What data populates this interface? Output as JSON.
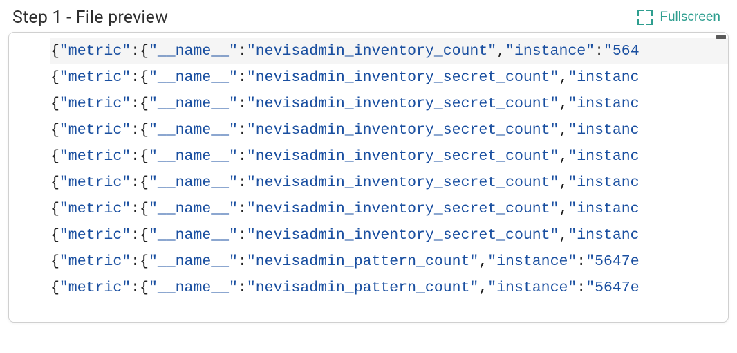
{
  "header": {
    "title": "Step 1 - File preview",
    "fullscreen_label": "Fullscreen"
  },
  "preview": {
    "lines": [
      {
        "tokens": [
          {
            "t": "punct",
            "v": "{"
          },
          {
            "t": "key",
            "v": "\"metric\""
          },
          {
            "t": "punct",
            "v": ":{"
          },
          {
            "t": "key",
            "v": "\"__name__\""
          },
          {
            "t": "punct",
            "v": ":"
          },
          {
            "t": "str",
            "v": "\"nevisadmin_inventory_count\""
          },
          {
            "t": "punct",
            "v": ","
          },
          {
            "t": "key",
            "v": "\"instance\""
          },
          {
            "t": "punct",
            "v": ":"
          },
          {
            "t": "str",
            "v": "\"564"
          }
        ],
        "first": true
      },
      {
        "tokens": [
          {
            "t": "punct",
            "v": "{"
          },
          {
            "t": "key",
            "v": "\"metric\""
          },
          {
            "t": "punct",
            "v": ":{"
          },
          {
            "t": "key",
            "v": "\"__name__\""
          },
          {
            "t": "punct",
            "v": ":"
          },
          {
            "t": "str",
            "v": "\"nevisadmin_inventory_secret_count\""
          },
          {
            "t": "punct",
            "v": ","
          },
          {
            "t": "key",
            "v": "\"instanc"
          }
        ]
      },
      {
        "tokens": [
          {
            "t": "punct",
            "v": "{"
          },
          {
            "t": "key",
            "v": "\"metric\""
          },
          {
            "t": "punct",
            "v": ":{"
          },
          {
            "t": "key",
            "v": "\"__name__\""
          },
          {
            "t": "punct",
            "v": ":"
          },
          {
            "t": "str",
            "v": "\"nevisadmin_inventory_secret_count\""
          },
          {
            "t": "punct",
            "v": ","
          },
          {
            "t": "key",
            "v": "\"instanc"
          }
        ]
      },
      {
        "tokens": [
          {
            "t": "punct",
            "v": "{"
          },
          {
            "t": "key",
            "v": "\"metric\""
          },
          {
            "t": "punct",
            "v": ":{"
          },
          {
            "t": "key",
            "v": "\"__name__\""
          },
          {
            "t": "punct",
            "v": ":"
          },
          {
            "t": "str",
            "v": "\"nevisadmin_inventory_secret_count\""
          },
          {
            "t": "punct",
            "v": ","
          },
          {
            "t": "key",
            "v": "\"instanc"
          }
        ]
      },
      {
        "tokens": [
          {
            "t": "punct",
            "v": "{"
          },
          {
            "t": "key",
            "v": "\"metric\""
          },
          {
            "t": "punct",
            "v": ":{"
          },
          {
            "t": "key",
            "v": "\"__name__\""
          },
          {
            "t": "punct",
            "v": ":"
          },
          {
            "t": "str",
            "v": "\"nevisadmin_inventory_secret_count\""
          },
          {
            "t": "punct",
            "v": ","
          },
          {
            "t": "key",
            "v": "\"instanc"
          }
        ]
      },
      {
        "tokens": [
          {
            "t": "punct",
            "v": "{"
          },
          {
            "t": "key",
            "v": "\"metric\""
          },
          {
            "t": "punct",
            "v": ":{"
          },
          {
            "t": "key",
            "v": "\"__name__\""
          },
          {
            "t": "punct",
            "v": ":"
          },
          {
            "t": "str",
            "v": "\"nevisadmin_inventory_secret_count\""
          },
          {
            "t": "punct",
            "v": ","
          },
          {
            "t": "key",
            "v": "\"instanc"
          }
        ]
      },
      {
        "tokens": [
          {
            "t": "punct",
            "v": "{"
          },
          {
            "t": "key",
            "v": "\"metric\""
          },
          {
            "t": "punct",
            "v": ":{"
          },
          {
            "t": "key",
            "v": "\"__name__\""
          },
          {
            "t": "punct",
            "v": ":"
          },
          {
            "t": "str",
            "v": "\"nevisadmin_inventory_secret_count\""
          },
          {
            "t": "punct",
            "v": ","
          },
          {
            "t": "key",
            "v": "\"instanc"
          }
        ]
      },
      {
        "tokens": [
          {
            "t": "punct",
            "v": "{"
          },
          {
            "t": "key",
            "v": "\"metric\""
          },
          {
            "t": "punct",
            "v": ":{"
          },
          {
            "t": "key",
            "v": "\"__name__\""
          },
          {
            "t": "punct",
            "v": ":"
          },
          {
            "t": "str",
            "v": "\"nevisadmin_inventory_secret_count\""
          },
          {
            "t": "punct",
            "v": ","
          },
          {
            "t": "key",
            "v": "\"instanc"
          }
        ]
      },
      {
        "tokens": [
          {
            "t": "punct",
            "v": "{"
          },
          {
            "t": "key",
            "v": "\"metric\""
          },
          {
            "t": "punct",
            "v": ":{"
          },
          {
            "t": "key",
            "v": "\"__name__\""
          },
          {
            "t": "punct",
            "v": ":"
          },
          {
            "t": "str",
            "v": "\"nevisadmin_pattern_count\""
          },
          {
            "t": "punct",
            "v": ","
          },
          {
            "t": "key",
            "v": "\"instance\""
          },
          {
            "t": "punct",
            "v": ":"
          },
          {
            "t": "str",
            "v": "\"5647e"
          }
        ]
      },
      {
        "tokens": [
          {
            "t": "punct",
            "v": "{"
          },
          {
            "t": "key",
            "v": "\"metric\""
          },
          {
            "t": "punct",
            "v": ":{"
          },
          {
            "t": "key",
            "v": "\"__name__\""
          },
          {
            "t": "punct",
            "v": ":"
          },
          {
            "t": "str",
            "v": "\"nevisadmin_pattern_count\""
          },
          {
            "t": "punct",
            "v": ","
          },
          {
            "t": "key",
            "v": "\"instance\""
          },
          {
            "t": "punct",
            "v": ":"
          },
          {
            "t": "str",
            "v": "\"5647e"
          }
        ]
      }
    ]
  }
}
